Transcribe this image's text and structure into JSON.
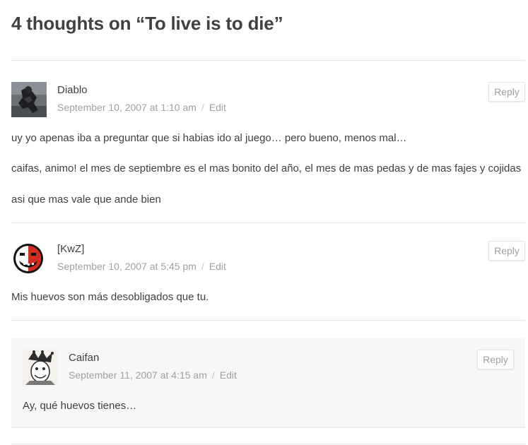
{
  "comments_title": "4 thoughts on “To live is to die”",
  "comments": [
    {
      "author": "Diablo",
      "date": "September 10, 2007 at 1:10 am",
      "edit_label": "Edit",
      "reply_label": "Reply",
      "paragraphs": [
        "uy yo apenas iba a preguntar que si habias ido al juego… pero bueno, menos mal…",
        "caifas, animo! el mes de septiembre es el mas bonito del año, el mes de mas pedas y de mas fajes y cojidas",
        "asi que mas vale que ande bien"
      ]
    },
    {
      "author": "[KwZ]",
      "date": "September 10, 2007 at 5:45 pm",
      "edit_label": "Edit",
      "reply_label": "Reply",
      "paragraphs": [
        "Mis huevos son más desobligados que tu."
      ]
    },
    {
      "author": "Caifan",
      "date": "September 11, 2007 at 4:15 am",
      "edit_label": "Edit",
      "reply_label": "Reply",
      "paragraphs": [
        "Ay, qué huevos tienes…"
      ]
    }
  ],
  "colors": {
    "text": "#404040",
    "meta": "#a0a0a0",
    "divider": "#e6e6e6",
    "child_background": "#f7f7f7",
    "kwz_avatar_red": "#d22b1f"
  },
  "icons": {
    "avatar_diablo": "photo-avatar",
    "avatar_kwz": "half-red-smiley-face-avatar",
    "avatar_caifan": "jester-drawing-avatar"
  }
}
